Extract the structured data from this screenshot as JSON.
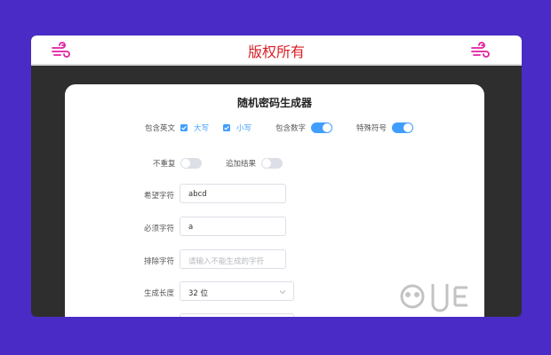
{
  "header": {
    "title": "版权所有",
    "left_icon": "wind-icon",
    "right_icon": "wind-icon",
    "accent_color": "#e01fa3"
  },
  "generator": {
    "title": "随机密码生成器",
    "include_letters_label": "包含英文",
    "uppercase_label": "大写",
    "lowercase_label": "小写",
    "include_digits_label": "包含数字",
    "special_chars_label": "特殊符号",
    "no_repeat_label": "不重复",
    "append_result_label": "追加结果",
    "uppercase_checked": true,
    "lowercase_checked": true,
    "include_digits_on": true,
    "special_chars_on": true,
    "no_repeat_on": false,
    "append_result_on": false,
    "desired_chars_label": "希望字符",
    "desired_chars_value": "abcd",
    "required_chars_label": "必须字符",
    "required_chars_value": "a",
    "exclude_chars_label": "排除字符",
    "exclude_chars_placeholder": "请输入不能生成的字符",
    "length_label": "生成长度",
    "length_value": "32 位"
  },
  "colors": {
    "background": "#4a2bc6",
    "switch_on": "#409eff",
    "switch_off": "#dcdfe6",
    "title_red": "#d81f26"
  }
}
